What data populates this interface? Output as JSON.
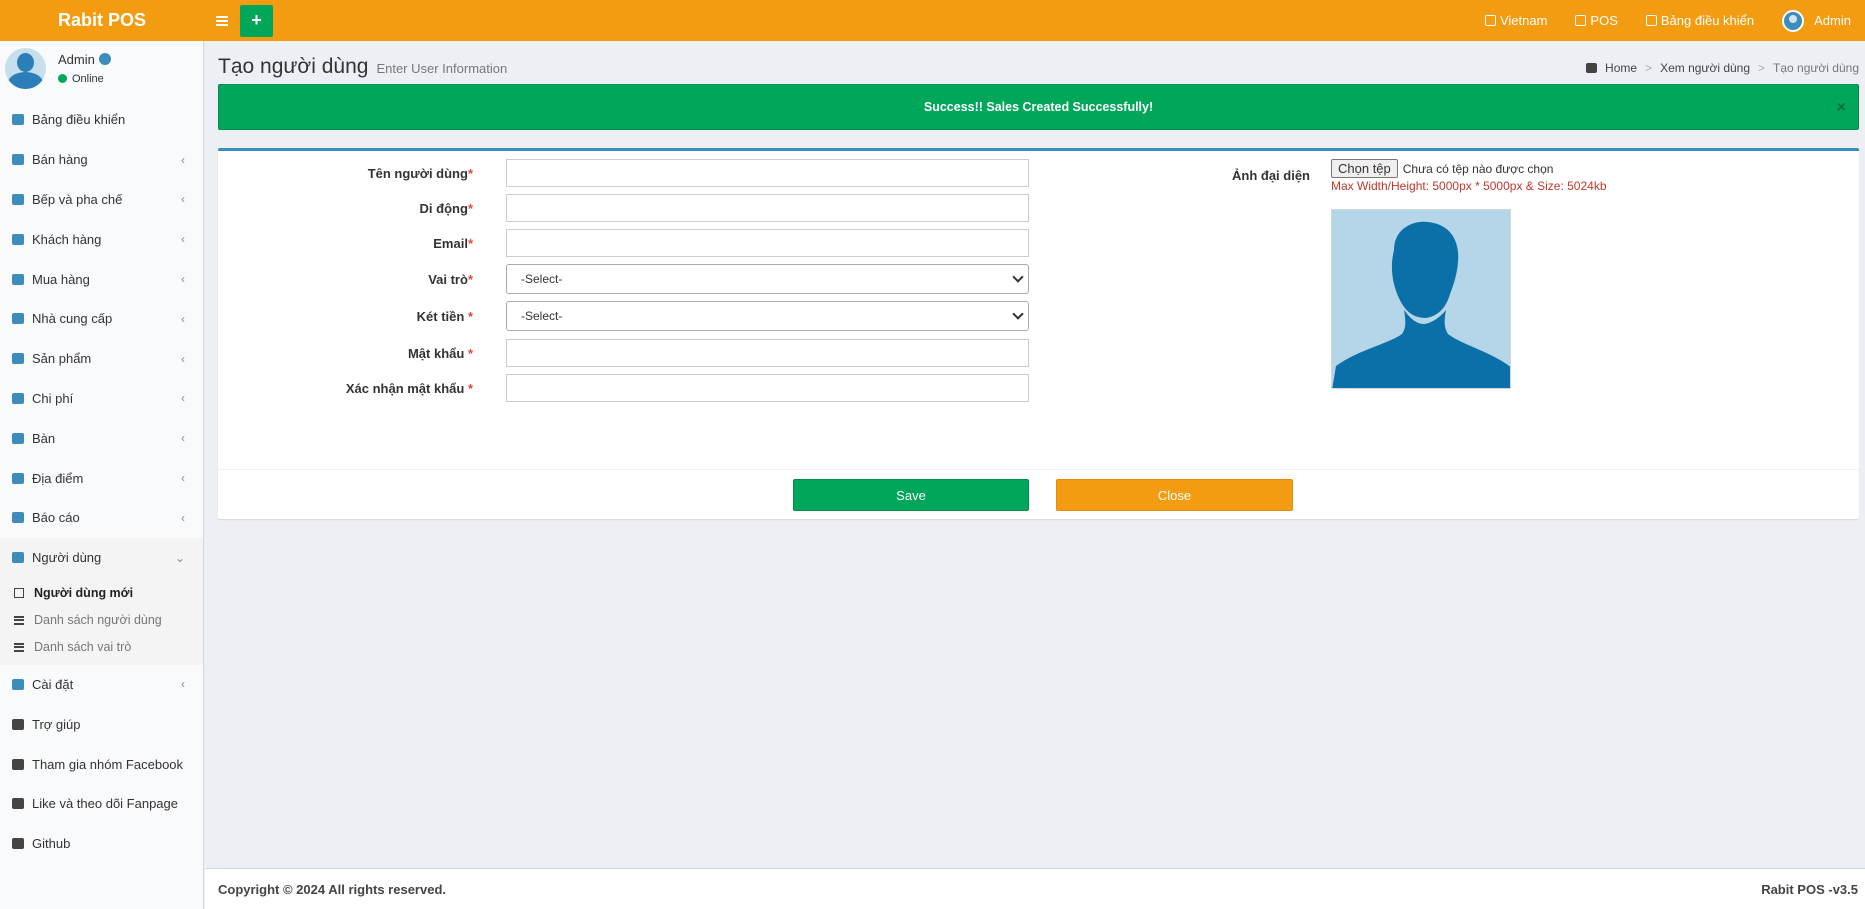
{
  "header": {
    "logo": "Rabit POS",
    "plus_label": "+",
    "right_items": [
      "Vietnam",
      "POS",
      "Bảng điều khiển"
    ],
    "user": "Admin"
  },
  "sidebar": {
    "user_name": "Admin",
    "user_status": "Online",
    "items": [
      {
        "label": "Bảng điều khiển",
        "icon": "dashboard-icon",
        "has_sub": false
      },
      {
        "label": "Bán hàng",
        "icon": "cart-icon",
        "has_sub": true
      },
      {
        "label": "Bếp và pha chế",
        "icon": "kitchen-icon",
        "has_sub": true
      },
      {
        "label": "Khách hàng",
        "icon": "users-icon",
        "has_sub": true
      },
      {
        "label": "Mua hàng",
        "icon": "grid-icon",
        "has_sub": true
      },
      {
        "label": "Nhà cung cấp",
        "icon": "user-plus-icon",
        "has_sub": true
      },
      {
        "label": "Sản phẩm",
        "icon": "cubes-icon",
        "has_sub": true
      },
      {
        "label": "Chi phí",
        "icon": "minus-circle-icon",
        "has_sub": true
      },
      {
        "label": "Bàn",
        "icon": "cutlery-icon",
        "has_sub": true
      },
      {
        "label": "Địa điểm",
        "icon": "paper-plane-icon",
        "has_sub": true
      },
      {
        "label": "Báo cáo",
        "icon": "bar-chart-icon",
        "has_sub": true
      },
      {
        "label": "Người dùng",
        "icon": "users-icon",
        "has_sub": true
      }
    ],
    "sub_items": [
      "Người dùng mới",
      "Danh sách người dùng",
      "Danh sách vai trò"
    ],
    "items_after": [
      {
        "label": "Cài đặt",
        "icon": "gears-icon",
        "has_sub": true
      },
      {
        "label": "Trợ giúp",
        "icon": "book-icon",
        "has_sub": false
      },
      {
        "label": "Tham gia nhóm Facebook",
        "icon": "briefcase-icon",
        "has_sub": false
      },
      {
        "label": "Like và theo dõi Fanpage",
        "icon": "briefcase-icon",
        "has_sub": false
      },
      {
        "label": "Github",
        "icon": "briefcase-icon",
        "has_sub": false
      }
    ]
  },
  "page": {
    "title": "Tạo người dùng",
    "subtitle": "Enter User Information",
    "breadcrumb": [
      "Home",
      "Xem người dùng",
      "Tạo người dùng"
    ]
  },
  "alert": {
    "text": "Success!! Sales Created Successfully!",
    "close": "×"
  },
  "form": {
    "fields": [
      {
        "label": "Tên người dùng",
        "req": "*",
        "type": "text",
        "value": ""
      },
      {
        "label": "Di động",
        "req": "*",
        "type": "text",
        "value": ""
      },
      {
        "label": "Email",
        "req": "*",
        "type": "text",
        "value": ""
      },
      {
        "label": "Vai trò",
        "req": "*",
        "type": "select",
        "value": "-Select-"
      },
      {
        "label": "Két tiền ",
        "req": "*",
        "type": "select",
        "value": "-Select-"
      },
      {
        "label": "Mật khẩu ",
        "req": "*",
        "type": "password",
        "value": ""
      },
      {
        "label": "Xác nhận mật khẩu ",
        "req": "*",
        "type": "password",
        "value": ""
      }
    ],
    "avatar_label": "Ảnh đại diện",
    "file_button": "Chọn tệp",
    "file_status": "Chưa có tệp nào được chọn",
    "file_hint": "Max Width/Height: 5000px * 5000px & Size: 5024kb",
    "save": "Save",
    "close": "Close"
  },
  "footer": {
    "copyright": "Copyright © 2024 All rights reserved.",
    "version": "Rabit POS -v3.5"
  },
  "colors": {
    "header": "#f39c12",
    "success": "#00a65a",
    "accent": "#3c8dbc"
  }
}
